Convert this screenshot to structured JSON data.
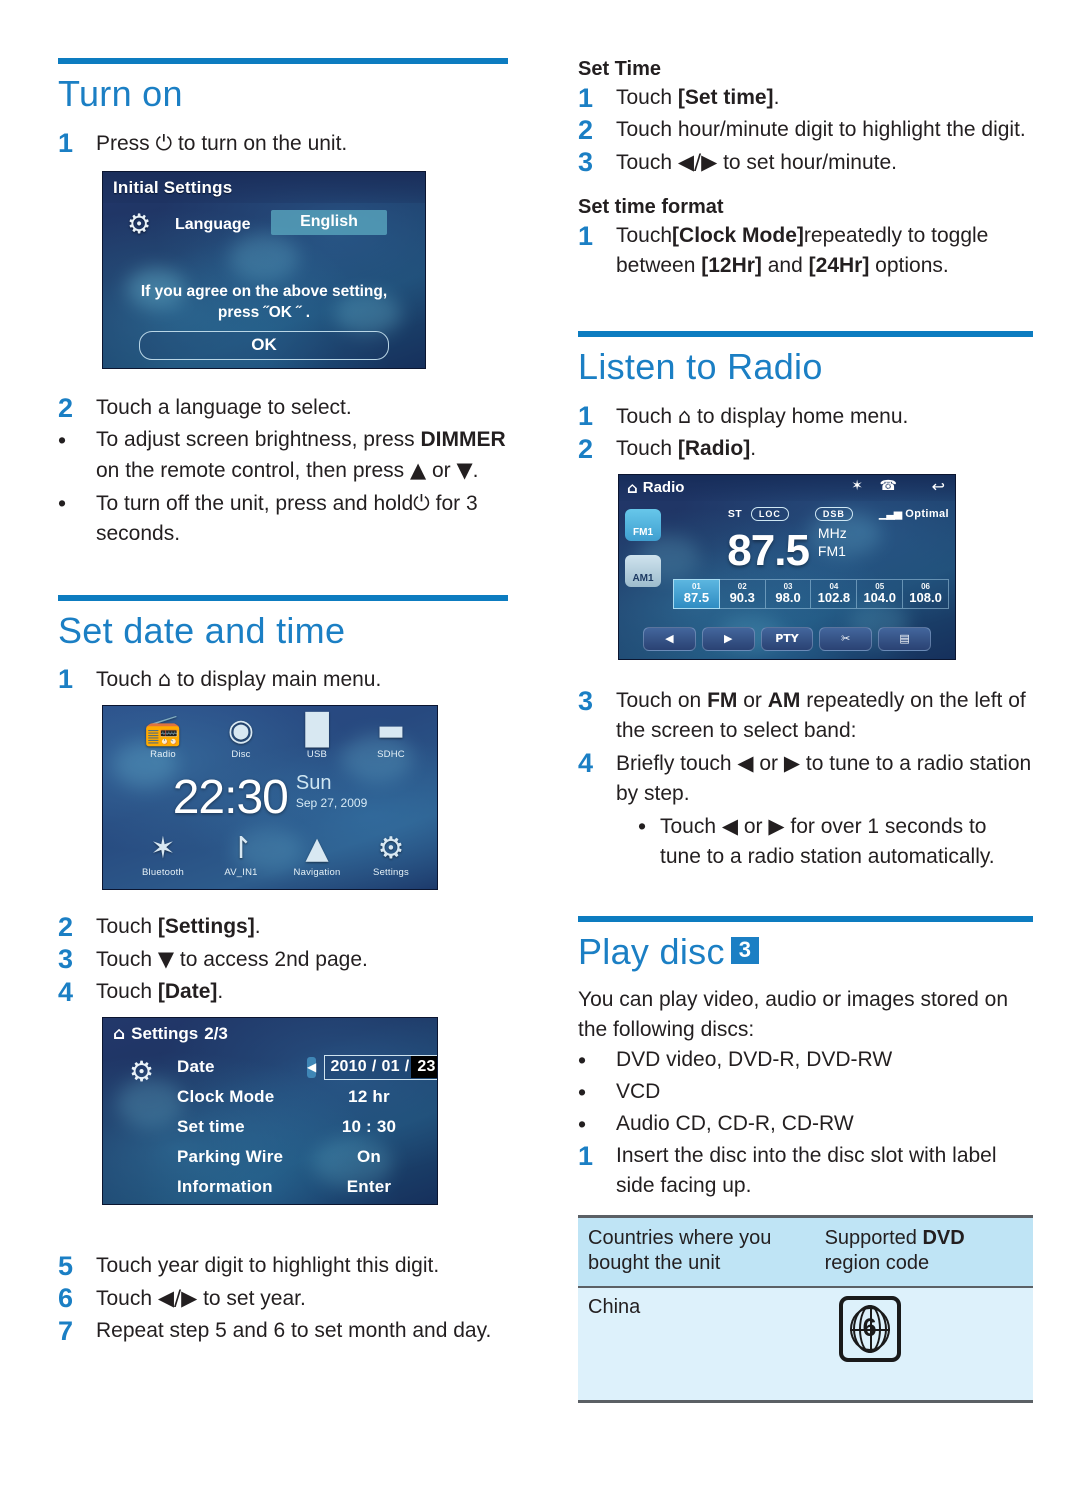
{
  "left_column": {
    "turn_on": {
      "heading": "Turn on",
      "steps": [
        {
          "num": "1",
          "parts": [
            {
              "t": "Press "
            },
            {
              "t": "⏻",
              "sym": true
            },
            {
              "t": " to turn on the unit."
            }
          ]
        }
      ],
      "initial_settings_screen": {
        "title": "Initial Settings",
        "gear_icon": "gear-icon",
        "row_label": "Language",
        "row_value": "English",
        "agree_line1": "If you agree on the above setting,",
        "agree_line2": "press ˝OK ˝ .",
        "ok_button": "OK"
      },
      "steps_after": [
        {
          "num": "2",
          "text": "Touch a language to select."
        },
        {
          "num": "•",
          "parts": [
            {
              "t": "To adjust screen brightness, press "
            },
            {
              "t": "DIMMER",
              "b": true
            },
            {
              "t": " on the remote control, then press "
            },
            {
              "t": "▲",
              "sym": true
            },
            {
              "t": " or "
            },
            {
              "t": "▼",
              "sym": true
            },
            {
              "t": "."
            }
          ]
        },
        {
          "num": "•",
          "parts": [
            {
              "t": "To turn off the unit, press and hold"
            },
            {
              "t": "⏻",
              "sym": true
            },
            {
              "t": " for 3 seconds."
            }
          ]
        }
      ]
    },
    "set_date_and_time": {
      "heading": "Set date and time",
      "step1": {
        "num": "1",
        "parts": [
          {
            "t": "Touch "
          },
          {
            "t": "⌂",
            "sym": true
          },
          {
            "t": " to display main menu."
          }
        ]
      },
      "main_menu_screen": {
        "tiles": [
          {
            "label": "Radio",
            "icon": "radio-icon",
            "glyph": "📻"
          },
          {
            "label": "Disc",
            "icon": "disc-icon",
            "glyph": "💿"
          },
          {
            "label": "USB",
            "icon": "usb-icon",
            "glyph": "🔌"
          },
          {
            "label": "SDHC",
            "icon": "sdcard-icon",
            "glyph": "▤"
          },
          {
            "label": "Bluetooth",
            "icon": "bluetooth-icon",
            "glyph": "✳"
          },
          {
            "label": "AV_IN1",
            "icon": "av-in-icon",
            "glyph": "↺"
          },
          {
            "label": "Navigation",
            "icon": "navigation-icon",
            "glyph": "➤"
          },
          {
            "label": "Settings",
            "icon": "gear-icon",
            "glyph": "⚙"
          }
        ],
        "time": "22:30",
        "day_of_week": "Sun",
        "date": "Sep 27, 2009"
      },
      "steps": [
        {
          "num": "2",
          "parts": [
            {
              "t": "Touch "
            },
            {
              "t": "[Settings]",
              "b": true
            },
            {
              "t": "."
            }
          ]
        },
        {
          "num": "3",
          "parts": [
            {
              "t": "Touch "
            },
            {
              "t": "▼",
              "sym": true
            },
            {
              "t": " to access 2nd page."
            }
          ]
        },
        {
          "num": "4",
          "parts": [
            {
              "t": "Touch "
            },
            {
              "t": "[Date]",
              "b": true
            },
            {
              "t": "."
            }
          ]
        }
      ],
      "settings_screen": {
        "home_icon": "home-icon",
        "title": "Settings",
        "page": "2/3",
        "gear_icon": "gear-icon",
        "rows": [
          {
            "label": "Date",
            "value": "",
            "date_year": "2010",
            "date_month": "01",
            "date_day": "23",
            "arrow": "◀"
          },
          {
            "label": "Clock Mode",
            "value": "12 hr"
          },
          {
            "label": "Set time",
            "value": "10 : 30"
          },
          {
            "label": "Parking Wire",
            "value": "On"
          },
          {
            "label": "Information",
            "value": "Enter"
          }
        ]
      },
      "steps_tail": [
        {
          "num": "5",
          "text": "Touch year digit to highlight this digit."
        },
        {
          "num": "6",
          "parts": [
            {
              "t": "Touch "
            },
            {
              "t": "◀/▶",
              "sym": true
            },
            {
              "t": " to set year."
            }
          ]
        },
        {
          "num": "7",
          "text": "Repeat step 5 and 6 to set month and day."
        }
      ]
    }
  },
  "right_column": {
    "set_time": {
      "subheading": "Set Time",
      "steps": [
        {
          "num": "1",
          "parts": [
            {
              "t": "Touch "
            },
            {
              "t": "[Set time]",
              "b": true
            },
            {
              "t": "."
            }
          ]
        },
        {
          "num": "2",
          "text": "Touch hour/minute digit to highlight the digit."
        },
        {
          "num": "3",
          "parts": [
            {
              "t": "Touch "
            },
            {
              "t": "◀/▶",
              "sym": true
            },
            {
              "t": " to set hour/minute."
            }
          ]
        }
      ]
    },
    "set_time_format": {
      "subheading": "Set time format",
      "steps": [
        {
          "num": "1",
          "parts": [
            {
              "t": "Touch"
            },
            {
              "t": "[Clock Mode]",
              "b": true
            },
            {
              "t": "repeatedly to toggle between "
            },
            {
              "t": "[12Hr]",
              "b": true
            },
            {
              "t": " and "
            },
            {
              "t": "[24Hr]",
              "b": true
            },
            {
              "t": " options."
            }
          ]
        }
      ]
    },
    "listen_to_radio": {
      "heading": "Listen to Radio",
      "steps_top": [
        {
          "num": "1",
          "parts": [
            {
              "t": "Touch "
            },
            {
              "t": "⌂",
              "sym": true
            },
            {
              "t": " to display home menu."
            }
          ]
        },
        {
          "num": "2",
          "parts": [
            {
              "t": "Touch "
            },
            {
              "t": "[Radio]",
              "b": true
            },
            {
              "t": "."
            }
          ]
        }
      ],
      "radio_screen": {
        "home_icon": "home-icon",
        "title": "Radio",
        "status_icons": [
          "bluetooth-icon",
          "phone-icon",
          "back-icon"
        ],
        "band_buttons": [
          {
            "label": "FM1",
            "active": true
          },
          {
            "label": "AM1",
            "active": false
          }
        ],
        "indicators": {
          "stereo": "ST",
          "loc": "LOC",
          "dsb": "DSB",
          "signal": "Optimal"
        },
        "frequency": "87.5",
        "unit": "MHz",
        "band": "FM1",
        "presets": [
          {
            "num": "01",
            "value": "87.5",
            "active": true
          },
          {
            "num": "02",
            "value": "90.3",
            "active": false
          },
          {
            "num": "03",
            "value": "98.0",
            "active": false
          },
          {
            "num": "04",
            "value": "102.8",
            "active": false
          },
          {
            "num": "05",
            "value": "104.0",
            "active": false
          },
          {
            "num": "06",
            "value": "108.0",
            "active": false
          }
        ],
        "controls": [
          {
            "label": "◀",
            "name": "tune-down-button"
          },
          {
            "label": "▶",
            "name": "tune-up-button"
          },
          {
            "label": "PTY",
            "name": "pty-button"
          },
          {
            "label": "✂",
            "name": "scan-button"
          },
          {
            "label": "▤",
            "name": "list-button"
          }
        ]
      },
      "steps_bottom": [
        {
          "num": "3",
          "parts": [
            {
              "t": "Touch on "
            },
            {
              "t": "FM",
              "b": true
            },
            {
              "t": " or "
            },
            {
              "t": "AM",
              "b": true
            },
            {
              "t": " repeatedly on the left of the screen to select band:"
            }
          ]
        },
        {
          "num": "4",
          "parts": [
            {
              "t": "Briefly touch "
            },
            {
              "t": "◀",
              "sym": true
            },
            {
              "t": " or "
            },
            {
              "t": "▶",
              "sym": true
            },
            {
              "t": " to tune to a radio station by step."
            }
          ]
        }
      ],
      "sub_bullet": {
        "num": "•",
        "parts": [
          {
            "t": "Touch "
          },
          {
            "t": "◀",
            "sym": true
          },
          {
            "t": " or "
          },
          {
            "t": "▶",
            "sym": true
          },
          {
            "t": " for over 1 seconds to tune to a radio station automatically."
          }
        ]
      }
    },
    "play_disc": {
      "heading": "Play disc",
      "badge": "3",
      "intro": "You can play video, audio or images stored on the following discs:",
      "bullets": [
        "DVD video, DVD-R, DVD-RW",
        "VCD",
        "Audio CD, CD-R, CD-RW"
      ],
      "step1": {
        "num": "1",
        "text": "Insert the disc into the disc slot with label side facing up."
      },
      "table": {
        "headers": [
          "Countries where you bought the unit",
          "Supported DVD region code"
        ],
        "header_bold_words": [
          "",
          "DVD"
        ],
        "rows": [
          {
            "country": "China",
            "region_code": "6"
          }
        ]
      }
    }
  },
  "colors": {
    "heading_blue": "#1b7fc4",
    "rule_blue": "#0d7cc0",
    "table_header_bg": "#bfe4f5",
    "table_row_bg": "#ddf1fb",
    "body_text": "#231f20"
  }
}
